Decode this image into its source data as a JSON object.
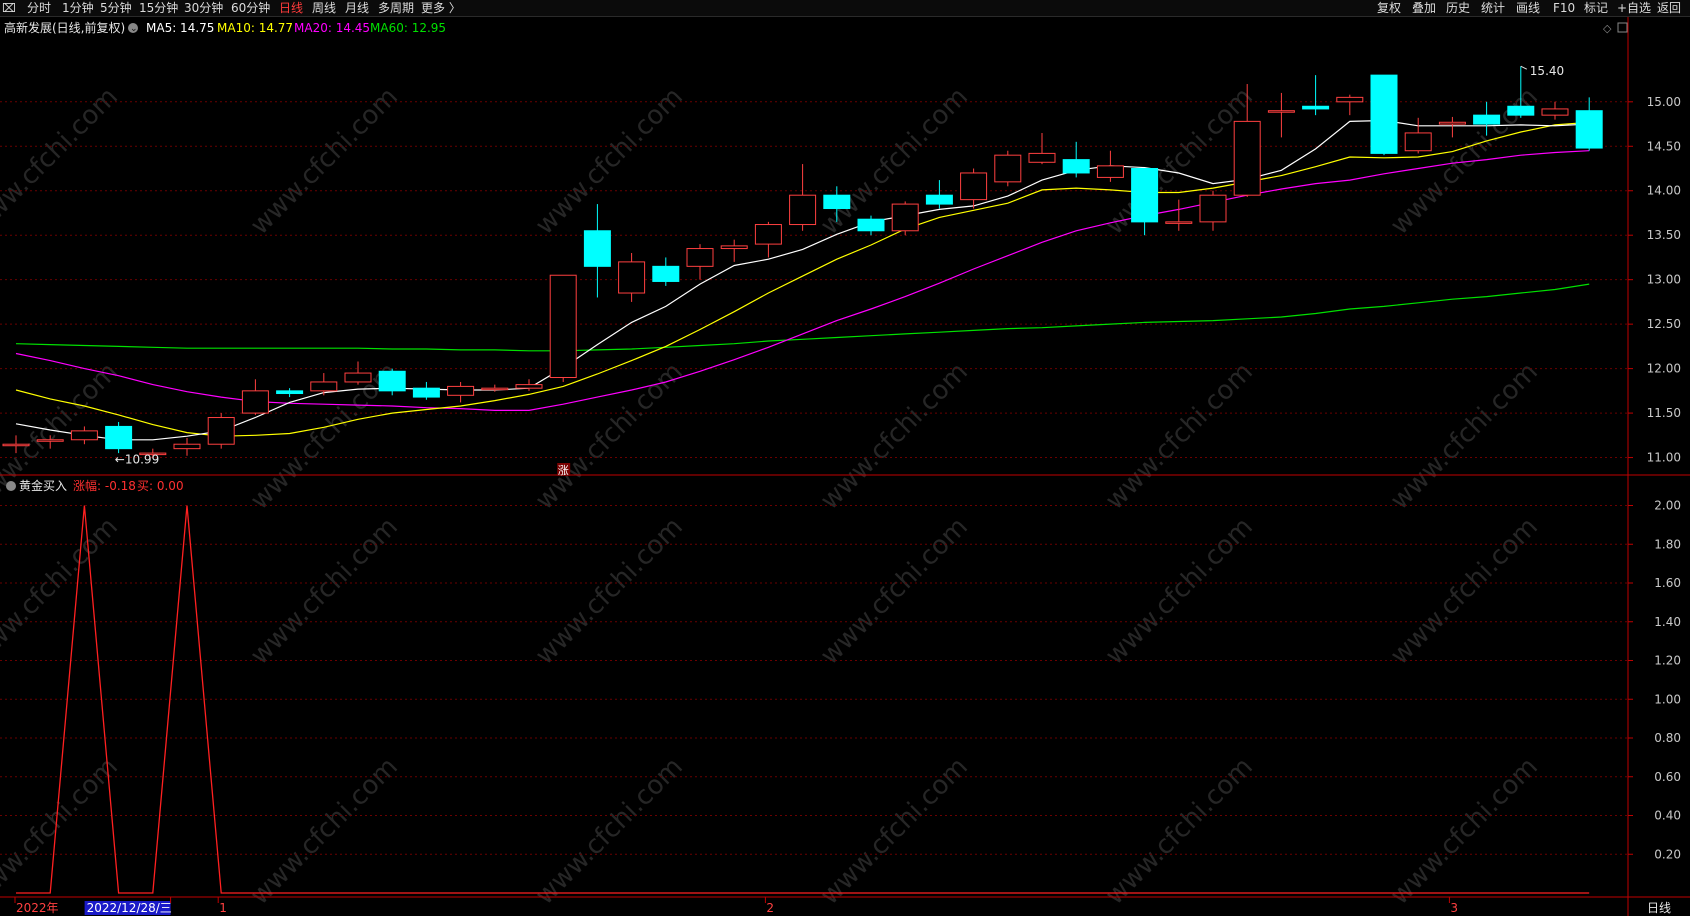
{
  "toolbar": {
    "left": [
      {
        "label": "分时",
        "active": false
      },
      {
        "label": "1分钟",
        "active": false
      },
      {
        "label": "5分钟",
        "active": false
      },
      {
        "label": "15分钟",
        "active": false
      },
      {
        "label": "30分钟",
        "active": false
      },
      {
        "label": "60分钟",
        "active": false
      },
      {
        "label": "日线",
        "active": true
      },
      {
        "label": "周线",
        "active": false
      },
      {
        "label": "月线",
        "active": false
      },
      {
        "label": "多周期",
        "active": false
      },
      {
        "label": "更多 〉",
        "active": false
      }
    ],
    "right": [
      "复权",
      "叠加",
      "历史",
      "统计",
      "画线",
      "F10",
      "标记",
      "+自选",
      "返回"
    ]
  },
  "colors": {
    "up": "#ff4040",
    "down": "#00ffff",
    "ma5": "#ffffff",
    "ma10": "#ffff00",
    "ma20": "#ff00ff",
    "ma60": "#00e000",
    "grid": "#6a0000",
    "axis": "#c00000",
    "indicator": "#ff2020",
    "watermark": "#262626"
  },
  "watermark": "www.cfchi.com",
  "main_legend": {
    "title": "高新发展(日线,前复权)",
    "items": [
      {
        "label": "MA5: 14.75",
        "color": "#ffffff"
      },
      {
        "label": "MA10: 14.77",
        "color": "#ffff00"
      },
      {
        "label": "MA20: 14.45",
        "color": "#ff00ff"
      },
      {
        "label": "MA60: 12.95",
        "color": "#00e000"
      }
    ]
  },
  "sub_legend": {
    "title": "黄金买入",
    "items": [
      {
        "label": "涨幅: -0.18",
        "color": "#ff3030"
      },
      {
        "label": "买: 0.00",
        "color": "#ff3030"
      }
    ]
  },
  "annotations": {
    "max_label": "15.40",
    "min_label": "10.99",
    "signal_label": "涨",
    "period_label": "日线"
  },
  "x_axis": {
    "labels": [
      {
        "text": "2022年",
        "index": 0
      },
      {
        "text": "2022/12/28/三",
        "index": 3,
        "highlight": true
      },
      {
        "text": "1",
        "index": 6
      },
      {
        "text": "2",
        "index": 22
      },
      {
        "text": "3",
        "index": 42
      }
    ]
  },
  "chart_data": [
    {
      "type": "candlestick",
      "title": "高新发展(日线,前复权)",
      "y_ticks": [
        11.0,
        11.5,
        12.0,
        12.5,
        13.0,
        13.5,
        14.0,
        14.5,
        15.0
      ],
      "ylim": [
        10.86,
        15.74
      ],
      "candles": [
        {
          "o": 11.15,
          "c": 11.15,
          "h": 11.25,
          "l": 11.05
        },
        {
          "o": 11.2,
          "c": 11.2,
          "h": 11.25,
          "l": 11.1
        },
        {
          "o": 11.2,
          "c": 11.3,
          "h": 11.35,
          "l": 11.15
        },
        {
          "o": 11.35,
          "c": 11.1,
          "h": 11.4,
          "l": 11.05
        },
        {
          "o": 11.05,
          "c": 11.05,
          "h": 11.1,
          "l": 10.99
        },
        {
          "o": 11.1,
          "c": 11.15,
          "h": 11.22,
          "l": 11.02
        },
        {
          "o": 11.15,
          "c": 11.45,
          "h": 11.5,
          "l": 11.1
        },
        {
          "o": 11.5,
          "c": 11.75,
          "h": 11.88,
          "l": 11.48
        },
        {
          "o": 11.75,
          "c": 11.72,
          "h": 11.78,
          "l": 11.68
        },
        {
          "o": 11.75,
          "c": 11.85,
          "h": 11.95,
          "l": 11.7
        },
        {
          "o": 11.85,
          "c": 11.95,
          "h": 12.08,
          "l": 11.82
        },
        {
          "o": 11.97,
          "c": 11.75,
          "h": 12.0,
          "l": 11.7
        },
        {
          "o": 11.78,
          "c": 11.68,
          "h": 11.85,
          "l": 11.65
        },
        {
          "o": 11.7,
          "c": 11.8,
          "h": 11.85,
          "l": 11.62
        },
        {
          "o": 11.78,
          "c": 11.78,
          "h": 11.82,
          "l": 11.74
        },
        {
          "o": 11.78,
          "c": 11.82,
          "h": 11.88,
          "l": 11.75
        },
        {
          "o": 11.9,
          "c": 13.05,
          "h": 13.05,
          "l": 11.85
        },
        {
          "o": 13.55,
          "c": 13.15,
          "h": 13.85,
          "l": 12.8
        },
        {
          "o": 12.85,
          "c": 13.2,
          "h": 13.3,
          "l": 12.75
        },
        {
          "o": 13.15,
          "c": 12.98,
          "h": 13.25,
          "l": 12.93
        },
        {
          "o": 13.15,
          "c": 13.35,
          "h": 13.4,
          "l": 13.0
        },
        {
          "o": 13.35,
          "c": 13.38,
          "h": 13.45,
          "l": 13.2
        },
        {
          "o": 13.4,
          "c": 13.62,
          "h": 13.65,
          "l": 13.25
        },
        {
          "o": 13.62,
          "c": 13.95,
          "h": 14.3,
          "l": 13.55
        },
        {
          "o": 13.95,
          "c": 13.8,
          "h": 14.05,
          "l": 13.65
        },
        {
          "o": 13.68,
          "c": 13.55,
          "h": 13.72,
          "l": 13.5
        },
        {
          "o": 13.55,
          "c": 13.85,
          "h": 13.88,
          "l": 13.5
        },
        {
          "o": 13.95,
          "c": 13.85,
          "h": 14.12,
          "l": 13.8
        },
        {
          "o": 13.9,
          "c": 14.2,
          "h": 14.25,
          "l": 13.8
        },
        {
          "o": 14.1,
          "c": 14.4,
          "h": 14.45,
          "l": 14.05
        },
        {
          "o": 14.32,
          "c": 14.42,
          "h": 14.65,
          "l": 14.3
        },
        {
          "o": 14.35,
          "c": 14.2,
          "h": 14.55,
          "l": 14.15
        },
        {
          "o": 14.15,
          "c": 14.28,
          "h": 14.45,
          "l": 14.1
        },
        {
          "o": 14.25,
          "c": 13.65,
          "h": 14.25,
          "l": 13.5
        },
        {
          "o": 13.65,
          "c": 13.65,
          "h": 13.9,
          "l": 13.55
        },
        {
          "o": 13.65,
          "c": 13.95,
          "h": 14.0,
          "l": 13.55
        },
        {
          "o": 13.95,
          "c": 14.78,
          "h": 15.2,
          "l": 13.93
        },
        {
          "o": 14.9,
          "c": 14.9,
          "h": 15.1,
          "l": 14.6
        },
        {
          "o": 14.95,
          "c": 14.92,
          "h": 15.3,
          "l": 14.85
        },
        {
          "o": 15.0,
          "c": 15.05,
          "h": 15.08,
          "l": 14.85
        },
        {
          "o": 15.3,
          "c": 14.42,
          "h": 15.3,
          "l": 14.4
        },
        {
          "o": 14.45,
          "c": 14.65,
          "h": 14.82,
          "l": 14.42
        },
        {
          "o": 14.75,
          "c": 14.77,
          "h": 14.83,
          "l": 14.6
        },
        {
          "o": 14.85,
          "c": 14.75,
          "h": 15.0,
          "l": 14.62
        },
        {
          "o": 14.95,
          "c": 14.85,
          "h": 15.4,
          "l": 14.82
        },
        {
          "o": 14.85,
          "c": 14.92,
          "h": 15.0,
          "l": 14.8
        },
        {
          "o": 14.9,
          "c": 14.48,
          "h": 15.05,
          "l": 14.45
        }
      ],
      "ma5": [
        11.38,
        11.31,
        11.25,
        11.2,
        11.2,
        11.24,
        11.3,
        11.45,
        11.62,
        11.73,
        11.77,
        11.78,
        11.77,
        11.76,
        11.76,
        11.78,
        12.01,
        12.27,
        12.52,
        12.7,
        12.95,
        13.16,
        13.23,
        13.34,
        13.51,
        13.65,
        13.72,
        13.79,
        13.83,
        13.94,
        14.12,
        14.23,
        14.28,
        14.26,
        14.2,
        14.08,
        14.13,
        14.23,
        14.47,
        14.78,
        14.79,
        14.73,
        14.73,
        14.73,
        14.74,
        14.73,
        14.75
      ],
      "ma10": [
        11.76,
        11.66,
        11.58,
        11.48,
        11.37,
        11.28,
        11.24,
        11.25,
        11.27,
        11.34,
        11.43,
        11.5,
        11.54,
        11.58,
        11.64,
        11.71,
        11.8,
        11.94,
        12.09,
        12.25,
        12.44,
        12.64,
        12.85,
        13.04,
        13.23,
        13.39,
        13.57,
        13.7,
        13.78,
        13.86,
        14.01,
        14.03,
        14.01,
        13.98,
        13.98,
        14.03,
        14.1,
        14.17,
        14.27,
        14.38,
        14.37,
        14.38,
        14.44,
        14.56,
        14.66,
        14.74,
        14.77
      ],
      "ma20": [
        12.17,
        12.09,
        12.0,
        11.92,
        11.82,
        11.74,
        11.68,
        11.63,
        11.61,
        11.6,
        11.59,
        11.58,
        11.56,
        11.55,
        11.53,
        11.53,
        11.6,
        11.68,
        11.76,
        11.85,
        11.97,
        12.1,
        12.24,
        12.39,
        12.54,
        12.67,
        12.81,
        12.96,
        13.12,
        13.27,
        13.42,
        13.55,
        13.64,
        13.72,
        13.79,
        13.87,
        13.95,
        14.02,
        14.08,
        14.12,
        14.19,
        14.25,
        14.31,
        14.35,
        14.4,
        14.43,
        14.45
      ],
      "ma60": [
        12.28,
        12.27,
        12.26,
        12.25,
        12.24,
        12.23,
        12.23,
        12.23,
        12.23,
        12.23,
        12.23,
        12.22,
        12.22,
        12.21,
        12.21,
        12.2,
        12.2,
        12.21,
        12.22,
        12.24,
        12.26,
        12.28,
        12.31,
        12.33,
        12.35,
        12.37,
        12.39,
        12.41,
        12.43,
        12.45,
        12.46,
        12.48,
        12.5,
        12.52,
        12.53,
        12.54,
        12.56,
        12.58,
        12.62,
        12.67,
        12.7,
        12.74,
        12.78,
        12.81,
        12.85,
        12.89,
        12.95
      ]
    },
    {
      "type": "line",
      "title": "黄金买入",
      "y_ticks": [
        0.2,
        0.4,
        0.6,
        0.8,
        1.0,
        1.2,
        1.4,
        1.6,
        1.8,
        2.0
      ],
      "ylim": [
        0.0,
        2.08
      ],
      "values": [
        0,
        0,
        2,
        0,
        0,
        2,
        0,
        0,
        0,
        0,
        0,
        0,
        0,
        0,
        0,
        0,
        0,
        0,
        0,
        0,
        0,
        0,
        0,
        0,
        0,
        0,
        0,
        0,
        0,
        0,
        0,
        0,
        0,
        0,
        0,
        0,
        0,
        0,
        0,
        0,
        0,
        0,
        0,
        0,
        0,
        0,
        0
      ]
    }
  ]
}
